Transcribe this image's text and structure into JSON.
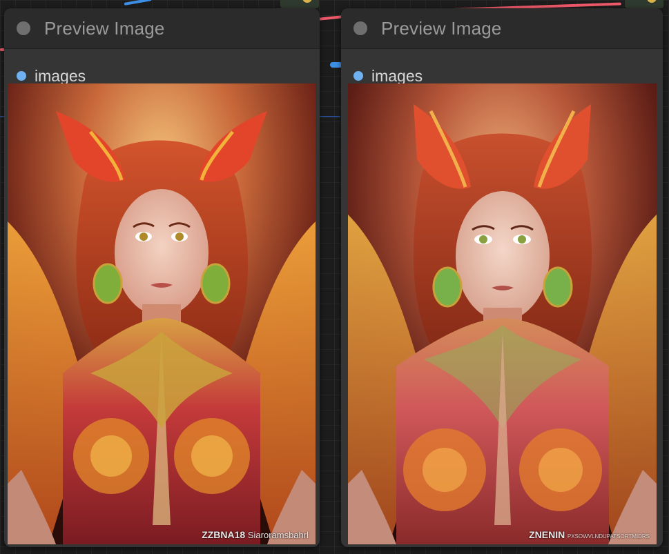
{
  "nodes": [
    {
      "title": "Preview Image",
      "input_slot": "images",
      "image": {
        "subject": "phoenix-woman-portrait",
        "watermark_main": "ZZBNA18",
        "watermark_sub": "Siaroramsbahrl"
      }
    },
    {
      "title": "Preview Image",
      "input_slot": "images",
      "image": {
        "subject": "phoenix-woman-portrait",
        "watermark_main": "ZNENIN",
        "watermark_sub": "PXSOWVLNDUPATSORTMIDRS"
      }
    }
  ],
  "colors": {
    "canvas_bg": "#1c1c1c",
    "node_body": "#353535",
    "node_header": "#2b2b2b",
    "title_text": "#9a9a9a",
    "slot_dot": "#6eb0f0",
    "wire_pink": "#f05a6a",
    "wire_blue": "#3d8fe6"
  },
  "icons": {
    "collapse": "collapse-dot-icon",
    "slot": "input-slot-dot-icon"
  }
}
